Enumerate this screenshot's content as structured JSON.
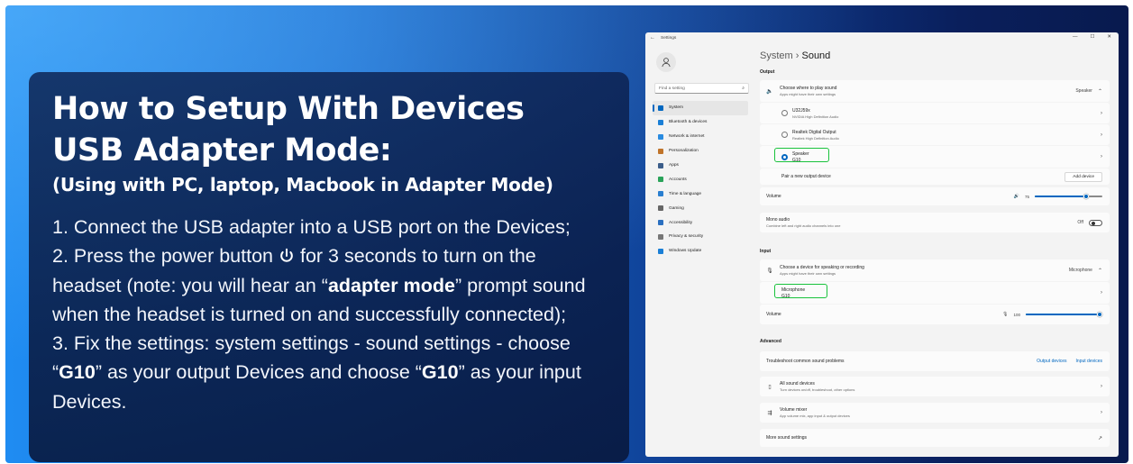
{
  "banner": {
    "title_line1": "How to Setup With Devices",
    "title_line2": "USB Adapter Mode:",
    "subtitle": "(Using with PC, laptop, Macbook in Adapter Mode)",
    "step1": "1. Connect the USB adapter into a USB port on the Devices;",
    "step2_a": "2. Press the power button",
    "step2_b": "for 3 seconds to turn on the headset (note: you will hear an “",
    "step2_bold": "adapter mode",
    "step2_c": "” prompt sound when the headset is turned on and successfully connected);",
    "step3_a": "3. Fix the settings: system settings - sound settings - choose “",
    "step3_bold1": "G10",
    "step3_b": "” as your output Devices and choose “",
    "step3_bold2": "G10",
    "step3_c": "” as your input Devices."
  },
  "window": {
    "title": "Settings",
    "search_placeholder": "Find a setting",
    "breadcrumb_parent": "System",
    "breadcrumb_sep": "›",
    "breadcrumb_current": "Sound",
    "nav": [
      {
        "label": "System",
        "color": "#0067c0"
      },
      {
        "label": "Bluetooth & devices",
        "color": "#1a7fd6"
      },
      {
        "label": "Network & internet",
        "color": "#2a8be0"
      },
      {
        "label": "Personalization",
        "color": "#c0742a"
      },
      {
        "label": "Apps",
        "color": "#3b5d8a"
      },
      {
        "label": "Accounts",
        "color": "#2aa35a"
      },
      {
        "label": "Time & language",
        "color": "#2a7fd0"
      },
      {
        "label": "Gaming",
        "color": "#666666"
      },
      {
        "label": "Accessibility",
        "color": "#2a6fc0"
      },
      {
        "label": "Privacy & security",
        "color": "#777777"
      },
      {
        "label": "Windows Update",
        "color": "#1a7fd6"
      }
    ],
    "output": {
      "heading": "Output",
      "choose_title": "Choose where to play sound",
      "choose_sub": "Apps might have their own settings",
      "choose_value": "Speaker",
      "devices": [
        {
          "name": "U32J59x",
          "sub": "NVIDIA High Definition Audio"
        },
        {
          "name": "Realtek Digital Output",
          "sub": "Realtek High Definition Audio"
        },
        {
          "name": "Speaker",
          "sub": "G10"
        }
      ],
      "pair_label": "Pair a new output device",
      "add_button": "Add device",
      "volume_label": "Volume",
      "volume_value": "75",
      "mono_title": "Mono audio",
      "mono_sub": "Combine left and right audio channels into one",
      "mono_state": "Off"
    },
    "input": {
      "heading": "Input",
      "choose_title": "Choose a device for speaking or recording",
      "choose_sub": "Apps might have their own settings",
      "choose_value": "Microphone",
      "device_name": "Microphone",
      "device_sub": "G10",
      "volume_label": "Volume",
      "volume_value": "100"
    },
    "advanced": {
      "heading": "Advanced",
      "troubleshoot": "Troubleshoot common sound problems",
      "output_link": "Output devices",
      "input_link": "Input devices",
      "all_title": "All sound devices",
      "all_sub": "Turn devices on/off, troubleshoot, other options",
      "mixer_title": "Volume mixer",
      "mixer_sub": "App volume mix, app input & output devices",
      "more": "More sound settings"
    }
  }
}
